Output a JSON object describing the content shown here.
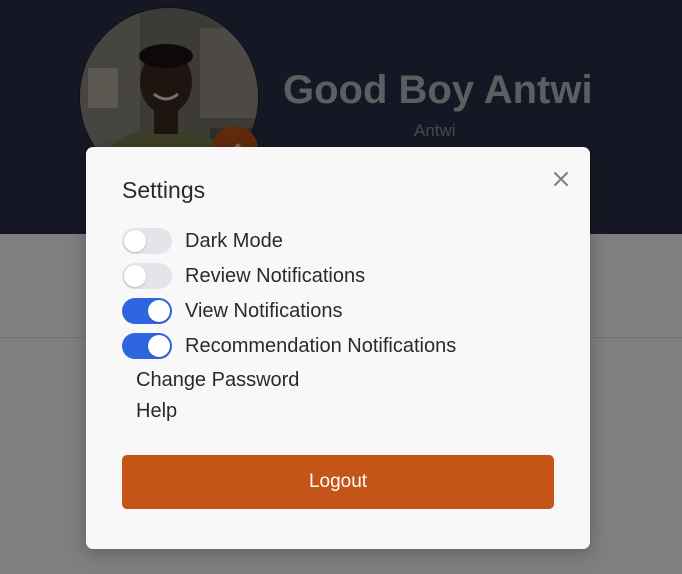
{
  "profile": {
    "name": "Good Boy Antwi",
    "username": "Antwi",
    "avatar_icon": "user-photo",
    "edit_icon": "pencil-icon"
  },
  "settings_modal": {
    "title": "Settings",
    "close_icon": "close-icon",
    "toggles": [
      {
        "label": "Dark Mode",
        "on": false
      },
      {
        "label": "Review Notifications",
        "on": false
      },
      {
        "label": "View Notifications",
        "on": true
      },
      {
        "label": "Recommendation Notifications",
        "on": true
      }
    ],
    "links": [
      {
        "label": "Change Password"
      },
      {
        "label": "Help"
      }
    ],
    "logout_label": "Logout"
  },
  "colors": {
    "header_bg": "#2a3148",
    "accent": "#c45516",
    "toggle_on": "#2f66e0",
    "toggle_off": "#e3e5ea"
  }
}
